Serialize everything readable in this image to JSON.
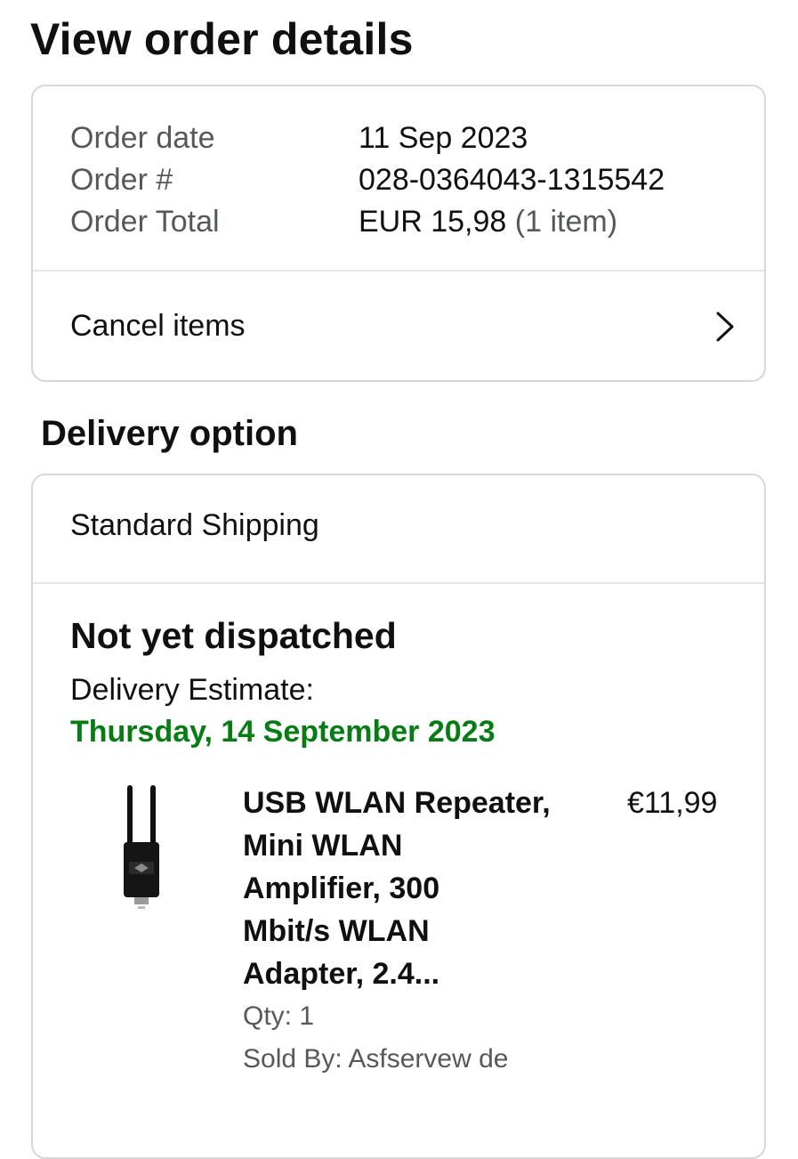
{
  "page": {
    "title": "View order details"
  },
  "order_summary": {
    "rows": [
      {
        "label": "Order date",
        "value": "11 Sep 2023"
      },
      {
        "label": "Order #",
        "value": "028-0364043-1315542"
      },
      {
        "label": "Order Total",
        "value": "EUR 15,98",
        "extra": "(1 item)"
      }
    ],
    "cancel_label": "Cancel items"
  },
  "delivery": {
    "section_title": "Delivery option",
    "shipping_method": "Standard Shipping",
    "status": "Not yet dispatched",
    "estimate_label": "Delivery Estimate:",
    "estimate_date": "Thursday, 14 September 2023",
    "estimate_color": "#067d12",
    "item": {
      "image_icon": "usb-wlan-adapter-image",
      "title_lines": [
        "USB WLAN Repeater,",
        "Mini WLAN",
        "Amplifier, 300",
        "Mbit/s WLAN",
        "Adapter, 2.4..."
      ],
      "price": "€11,99",
      "qty": "Qty: 1",
      "sold_by": "Sold By: Asfservew de"
    }
  }
}
